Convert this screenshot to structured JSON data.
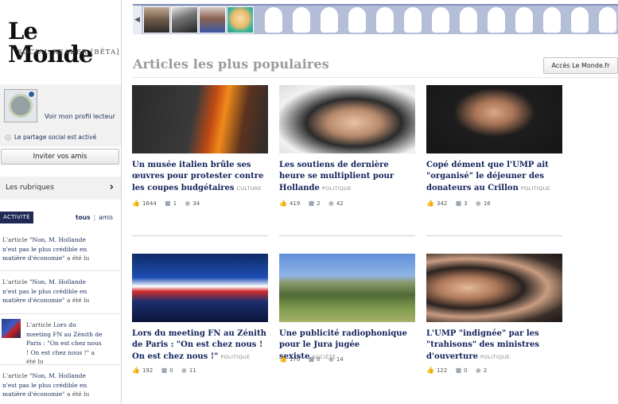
{
  "brand": {
    "logo": "Le Monde",
    "subtitle": "SOCIAL READER [BÊTA]"
  },
  "profile": {
    "link_label": "Voir mon profil lecteur",
    "share_status": "Le partage social est activé",
    "invite_label": "Inviter vos amis"
  },
  "rubriques_label": "Les rubriques",
  "activity": {
    "tag": "ACTIVITÉ",
    "filter_all": "tous",
    "filter_friends": "amis",
    "items": [
      {
        "prefix": "L'article ",
        "title": "\"Non, M. Hollande n'est pas le plus crédible en matière d'économie\"",
        "suffix": " a été lu"
      },
      {
        "prefix": "L'article ",
        "title": "\"Non, M. Hollande n'est pas le plus crédible en matière d'économie\"",
        "suffix": " a été lu"
      },
      {
        "prefix": "L'article ",
        "title": "Lors du meeting FN au Zénith de Paris : \"On est chez nous ! On est chez nous !\"",
        "suffix": " a été lu"
      },
      {
        "prefix": "L'article ",
        "title": "\"Non, M. Hollande n'est pas le plus crédible en matière d'économie\"",
        "suffix": " a été lu"
      }
    ]
  },
  "header": {
    "section_title": "Articles les plus populaires",
    "lemonde_button": "Accès Le Monde.fr"
  },
  "articles": [
    {
      "title": "Un musée italien brûle ses œuvres pour protester contre les coupes budgétaires",
      "rubric": "CULTURE",
      "likes": "1644",
      "comments": "1",
      "views": "34"
    },
    {
      "title": "Les soutiens de dernière heure se multiplient pour Hollande",
      "rubric": "POLITIQUE",
      "likes": "419",
      "comments": "2",
      "views": "42"
    },
    {
      "title": "Copé dément que l'UMP ait \"organisé\" le déjeuner des donateurs au Crillon",
      "rubric": "POLITIQUE",
      "likes": "342",
      "comments": "3",
      "views": "16"
    },
    {
      "title": "Lors du meeting FN au Zénith de Paris : \"On est chez nous ! On est chez nous !\"",
      "rubric": "POLITIQUE",
      "likes": "192",
      "comments": "0",
      "views": "11"
    },
    {
      "title": "Une publicité radiophonique pour le Jura jugée sexiste",
      "rubric": "SOCIÉTÉ",
      "likes": "170",
      "comments": "0",
      "views": "14"
    },
    {
      "title": "L'UMP \"indignée\" par les \"trahisons\" des ministres d'ouverture",
      "rubric": "POLITIQUE",
      "likes": "122",
      "comments": "0",
      "views": "2"
    }
  ],
  "stat_icons": [
    "like-icon",
    "comment-icon",
    "eye-icon"
  ],
  "colors": {
    "title_navy": "#12225a",
    "activity_tag": "#1e2a55",
    "strip_blue": "#b4bed9",
    "section_title_gray": "#9a9a9a"
  }
}
